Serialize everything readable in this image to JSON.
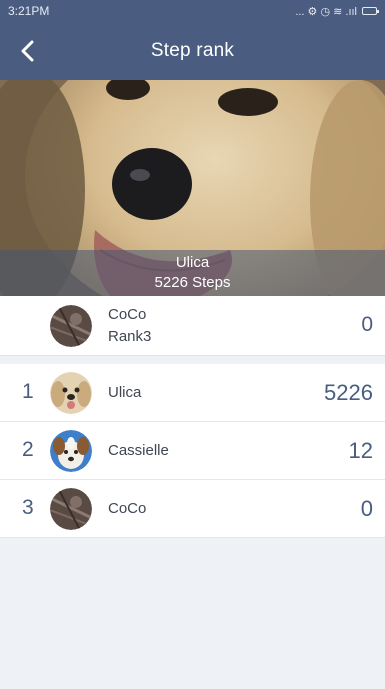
{
  "status_bar": {
    "time": "3:21PM",
    "icons_text": "... ⚙ ◷ ≋ .ııl"
  },
  "nav": {
    "title": "Step rank",
    "back_icon": "chevron-left-icon"
  },
  "hero": {
    "name": "Ulica",
    "steps_label": "5226 Steps"
  },
  "my_rank": {
    "name": "CoCo",
    "rank_label": "Rank3",
    "steps": "0"
  },
  "ranking": [
    {
      "rank": "1",
      "name": "Ulica",
      "steps": "5226",
      "avatar": "yellow-labrador-avatar"
    },
    {
      "rank": "2",
      "name": "Cassielle",
      "steps": "12",
      "avatar": "beagle-mix-avatar"
    },
    {
      "rank": "3",
      "name": "CoCo",
      "steps": "0",
      "avatar": "dark-photo-avatar"
    }
  ],
  "colors": {
    "header": "#4a5d80",
    "accent_text": "#4a5d80",
    "background": "#eef2f6"
  }
}
